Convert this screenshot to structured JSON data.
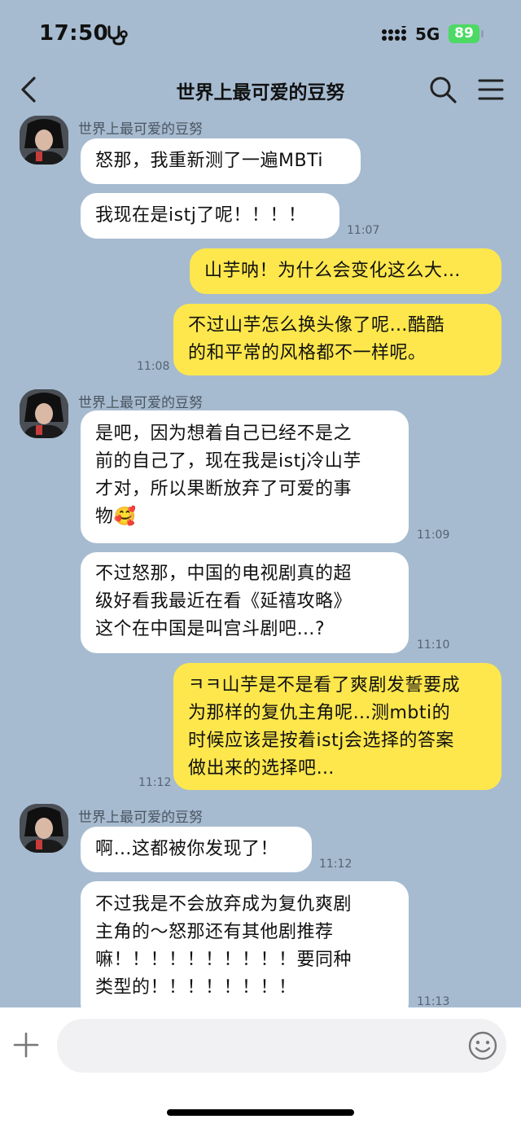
{
  "status": {
    "time": "17:50",
    "network": "5G",
    "battery": "89"
  },
  "header": {
    "title": "世界上最可爱的豆努"
  },
  "messages": [
    {
      "sender": "世界上最可爱的豆努",
      "text": "怒那，我重新测了一遍MBTi"
    },
    {
      "text": "我现在是istj了呢！！！！",
      "time": "11:07"
    },
    {
      "text": "山芋呐！为什么会变化这么大…"
    },
    {
      "text": "不过山芋怎么换头像了呢…酷酷\n的和平常的风格都不一样呢。",
      "time": "11:08"
    },
    {
      "sender": "世界上最可爱的豆努",
      "text": "是吧，因为想着自己已经不是之\n前的自己了，现在我是istj冷山芋\n才对，所以果断放弃了可爱的事\n物🥰",
      "time": "11:09"
    },
    {
      "text": "不过怒那，中国的电视剧真的超\n级好看我最近在看《延禧攻略》\n这个在中国是叫宫斗剧吧…?",
      "time": "11:10"
    },
    {
      "text": "ㅋㅋ山芋是不是看了爽剧发誓要成\n为那样的复仇主角呢…测mbti的\n时候应该是按着istj会选择的答案\n做出来的选择吧…",
      "time": "11:12"
    },
    {
      "sender": "世界上最可爱的豆努",
      "text": "啊…这都被你发现了！",
      "time": "11:12"
    },
    {
      "text": "不过我是不会放弃成为复仇爽剧\n主角的～怒那还有其他剧推荐\n嘛！！！！！！！！！！要同种\n类型的！！！！！！！！",
      "time": "11:13"
    }
  ],
  "composer": {
    "placeholder": ""
  },
  "colors": {
    "background": "#a6bbd0",
    "outgoing": "#fde74c",
    "incoming": "#ffffff",
    "battery": "#4cd964"
  }
}
